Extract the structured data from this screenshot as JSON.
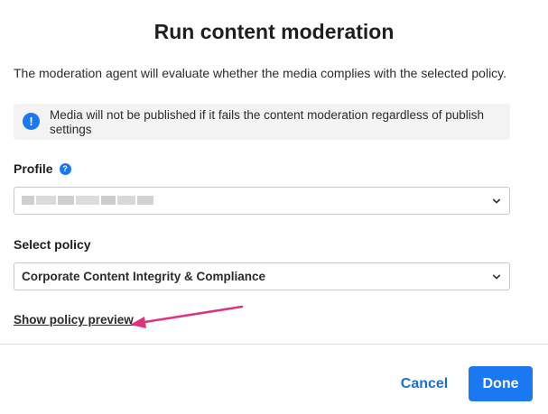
{
  "dialog": {
    "title": "Run content moderation",
    "description": "The moderation agent will evaluate whether the media complies with the selected policy.",
    "notice": {
      "icon": "info-icon",
      "text": "Media will not be published if it fails the content moderation regardless of publish settings"
    }
  },
  "profile": {
    "label": "Profile",
    "help_icon": "question-icon",
    "value_obscured": true
  },
  "policy": {
    "label": "Select policy",
    "value": "Corporate Content Integrity & Compliance"
  },
  "preview_link": "Show policy preview",
  "annotation_arrow_color": "#e0337f",
  "actions": {
    "cancel": "Cancel",
    "done": "Done"
  },
  "colors": {
    "accent": "#1a78f2",
    "link": "#1a6fde",
    "notice_bg": "#f3f3f4"
  }
}
